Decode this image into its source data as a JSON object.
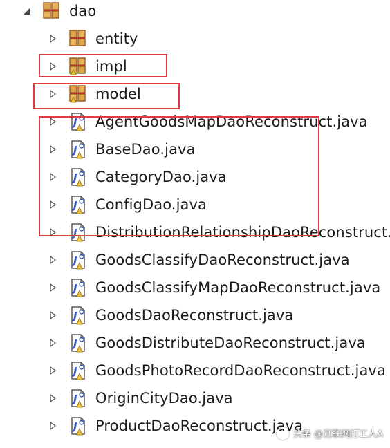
{
  "tree": {
    "root": {
      "label": "dao",
      "expanded": true,
      "icon": "package-icon"
    },
    "packages": [
      {
        "label": "entity",
        "icon": "package-icon"
      },
      {
        "label": "impl",
        "icon": "package-icon"
      },
      {
        "label": "model",
        "icon": "package-icon"
      }
    ],
    "files": [
      {
        "label": "AgentGoodsMapDaoReconstruct.java",
        "icon": "java-interface-icon"
      },
      {
        "label": "BaseDao.java",
        "icon": "java-interface-icon"
      },
      {
        "label": "CategoryDao.java",
        "icon": "java-interface-icon"
      },
      {
        "label": "ConfigDao.java",
        "icon": "java-interface-icon"
      },
      {
        "label": "DistributionRelationshipDaoReconstruct.java",
        "icon": "java-interface-icon"
      },
      {
        "label": "GoodsClassifyDaoReconstruct.java",
        "icon": "java-interface-icon"
      },
      {
        "label": "GoodsClassifyMapDaoReconstruct.java",
        "icon": "java-interface-icon"
      },
      {
        "label": "GoodsDaoReconstruct.java",
        "icon": "java-interface-icon"
      },
      {
        "label": "GoodsDistributeDaoReconstruct.java",
        "icon": "java-interface-icon"
      },
      {
        "label": "GoodsPhotoRecordDaoReconstruct.java",
        "icon": "java-interface-icon"
      },
      {
        "label": "OriginCityDao.java",
        "icon": "java-interface-icon"
      },
      {
        "label": "ProductDaoReconstruct.java",
        "icon": "java-interface-icon"
      }
    ]
  },
  "colors": {
    "highlight": "#e0393f",
    "package_brown": "#c8873a",
    "package_red": "#d33a2c",
    "java_blue": "#3b5fc0",
    "java_yellow": "#f3c23a"
  },
  "watermark": {
    "text": "头条 @互联网打工人A"
  }
}
